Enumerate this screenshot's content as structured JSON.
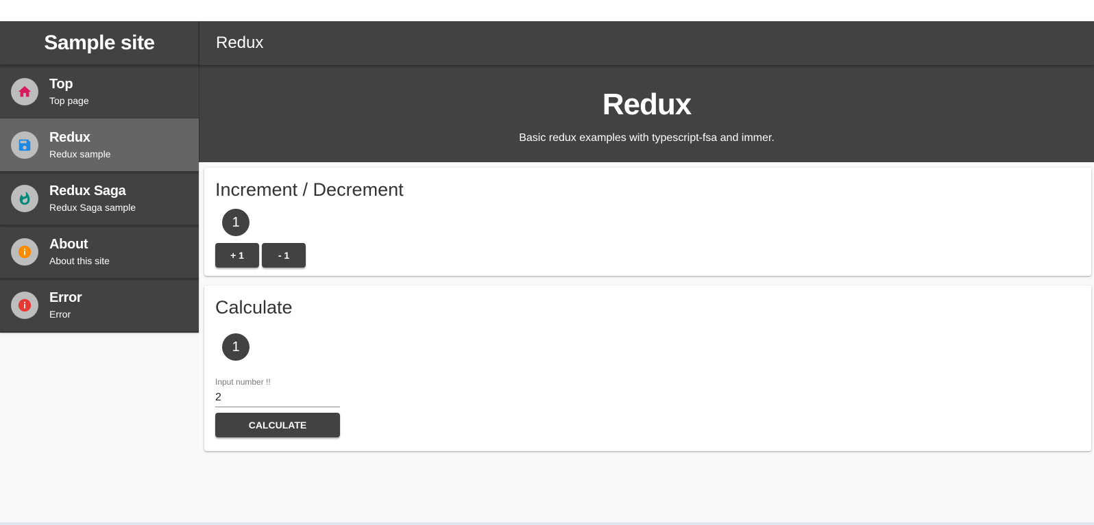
{
  "sidebar": {
    "brand": "Sample site",
    "items": [
      {
        "title": "Top",
        "subtitle": "Top page",
        "icon": "home-icon",
        "icon_color": "#d81b60"
      },
      {
        "title": "Redux",
        "subtitle": "Redux sample",
        "icon": "save-icon",
        "icon_color": "#1e88e5"
      },
      {
        "title": "Redux Saga",
        "subtitle": "Redux Saga sample",
        "icon": "flame-icon",
        "icon_color": "#00897b"
      },
      {
        "title": "About",
        "subtitle": "About this site",
        "icon": "info-icon",
        "icon_color": "#fb8c00"
      },
      {
        "title": "Error",
        "subtitle": "Error",
        "icon": "error-icon",
        "icon_color": "#e53935"
      }
    ],
    "active_index": 1
  },
  "appbar": {
    "title": "Redux"
  },
  "hero": {
    "title": "Redux",
    "subtitle": "Basic redux examples with typescript-fsa and immer."
  },
  "increment_card": {
    "title": "Increment / Decrement",
    "count": "1",
    "plus_label": "+ 1",
    "minus_label": "- 1"
  },
  "calculate_card": {
    "title": "Calculate",
    "count": "1",
    "input_label": "Input number !!",
    "input_value": "2",
    "button_label": "CALCULATE"
  },
  "colors": {
    "dark": "#424242",
    "active_item": "#656565",
    "background": "#f9f9f9"
  }
}
